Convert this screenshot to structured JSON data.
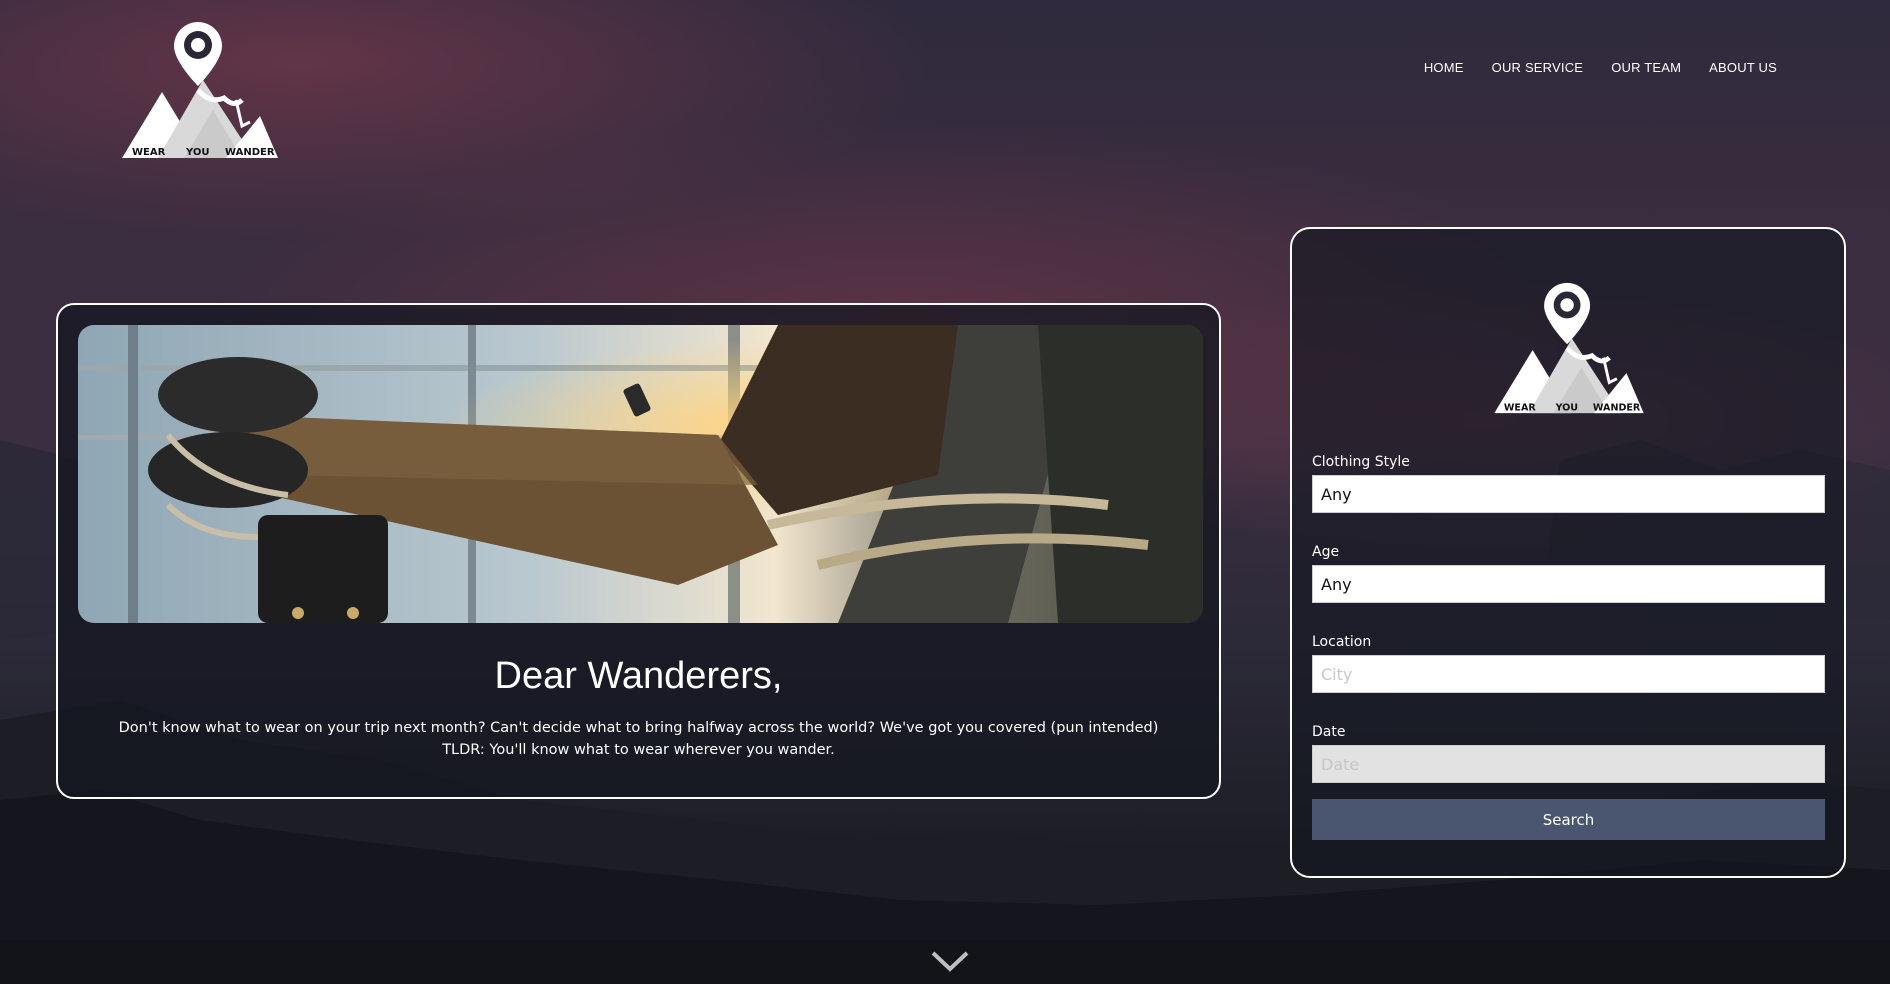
{
  "brand": {
    "logo_words": [
      "WEAR",
      "YOU",
      "WANDER"
    ]
  },
  "nav": {
    "items": [
      {
        "label": "HOME"
      },
      {
        "label": "OUR SERVICE"
      },
      {
        "label": "OUR TEAM"
      },
      {
        "label": "ABOUT US"
      }
    ]
  },
  "hero": {
    "title": "Dear Wanderers,",
    "line1": "Don't know what to wear on your trip next month? Can't decide what to bring halfway across the world? We've got you covered (pun intended)",
    "line2": "TLDR: You'll know what to wear wherever you wander."
  },
  "form": {
    "clothing_style": {
      "label": "Clothing Style",
      "value": "Any"
    },
    "age": {
      "label": "Age",
      "value": "Any"
    },
    "location": {
      "label": "Location",
      "value": "",
      "placeholder": "City"
    },
    "date": {
      "label": "Date",
      "value": "",
      "placeholder": "Date"
    },
    "search_label": "Search"
  },
  "colors": {
    "button": "#4a5670",
    "card_border": "#ffffff",
    "text": "#ffffff"
  },
  "icons": {
    "scroll_down": "chevron-down-icon",
    "logo": "map-pin-mountain-logo"
  }
}
